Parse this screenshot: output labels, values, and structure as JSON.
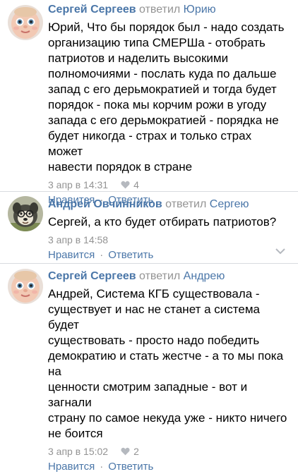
{
  "comments": [
    {
      "author": "Сергей Сергеев",
      "verb": "ответил",
      "target": "Юрию",
      "lines": [
        "Юрий, Что бы порядок был - надо создать",
        "организацию типа СМЕРШа - отобрать",
        "патриотов и наделить высокими",
        "полномочиями - послать куда по дальше",
        "запад с его дерьмократией и тогда будет",
        "порядок - пока мы корчим рожи в угоду",
        "запада с его дерьмократией - порядка не",
        "будет никогда - страх и только страх может",
        "навести порядок в стране"
      ],
      "date": "3 апр в 14:31",
      "likes": "4",
      "reply_label": "Нравится",
      "answer_label": "Ответить"
    },
    {
      "author": "Андрей Овчинников",
      "verb": "ответил",
      "target": "Сергею",
      "lines": [
        "Сергей, а кто будет отбирать патриотов?"
      ],
      "date": "3 апр в 14:58",
      "likes": "",
      "reply_label": "Нравится",
      "answer_label": "Ответить"
    },
    {
      "author": "Сергей Сергеев",
      "verb": "ответил",
      "target": "Андрею",
      "lines": [
        "Андрей, Система КГБ существовала -",
        "существует и нас не станет а система будет",
        "существовать - просто надо победить",
        "демократию и стать жестче - а то мы пока на",
        "ценности смотрим западные - вот и загнали",
        "страну по самое некуда уже - никто ничего",
        "не боится"
      ],
      "date": "3 апр в 15:02",
      "likes": "2",
      "reply_label": "Нравится",
      "answer_label": "Ответить"
    }
  ],
  "icons": {
    "like": "heart-icon",
    "more": "chevron-down-icon",
    "avatar_baby": "baby-face-avatar",
    "avatar_dog": "dog-avatar"
  },
  "colors": {
    "link": "#4a76a8",
    "meta": "#939393",
    "divider": "#d8dbe0"
  }
}
